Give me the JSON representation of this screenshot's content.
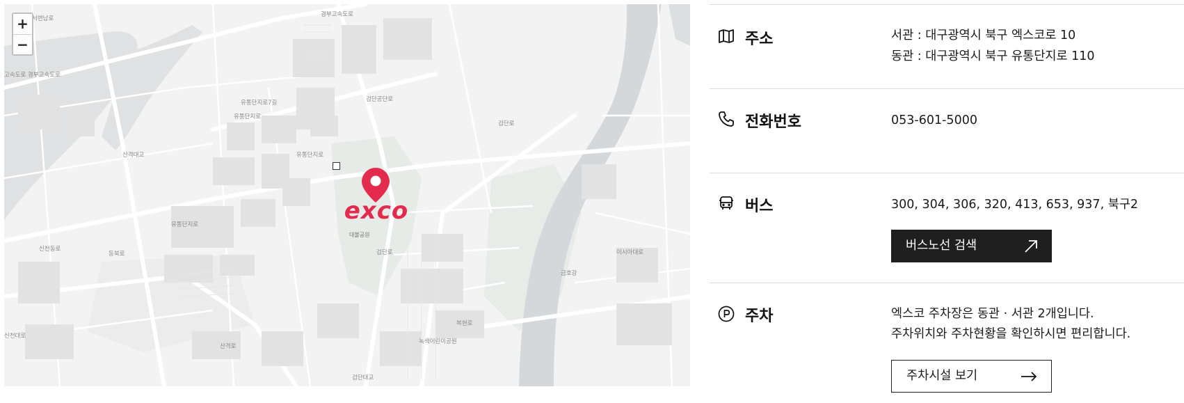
{
  "map": {
    "zoom_in_label": "+",
    "zoom_out_label": "−",
    "logo_text": "exco",
    "park_label": "대불공원",
    "road_labels": [
      "서변남로",
      "경부고속도로",
      "고속도로 경부고속도로",
      "유통단지로",
      "유통단지로7길",
      "유통단지로",
      "검단공단로",
      "검단로",
      "산격대교",
      "신천동로",
      "동북로",
      "신천대로",
      "금호강",
      "검단로",
      "대불공원",
      "유통단지로",
      "녹색어린이공원",
      "복현로",
      "이시아대로",
      "산격로",
      "검단대교"
    ],
    "marker_color": "#e32b4e"
  },
  "info": {
    "address": {
      "label": "주소",
      "icon": "map-icon",
      "lines": [
        "서관 : 대구광역시 북구 엑스코로 10",
        "동관 : 대구광역시 북구 유통단지로 110"
      ]
    },
    "phone": {
      "label": "전화번호",
      "icon": "phone-icon",
      "number": "053-601-5000"
    },
    "bus": {
      "label": "버스",
      "icon": "bus-icon",
      "routes": "300, 304, 306, 320, 413, 653, 937, 북구2",
      "button_label": "버스노선 검색"
    },
    "parking": {
      "label": "주차",
      "icon": "parking-icon",
      "lines": [
        "엑스코 주차장은 동관 · 서관 2개입니다.",
        "주차위치와 주차현황을 확인하시면 편리합니다."
      ],
      "button_label": "주차시설 보기"
    },
    "colors": {
      "button_dark": "#1f1f1f",
      "divider": "#dcdcdc"
    }
  }
}
